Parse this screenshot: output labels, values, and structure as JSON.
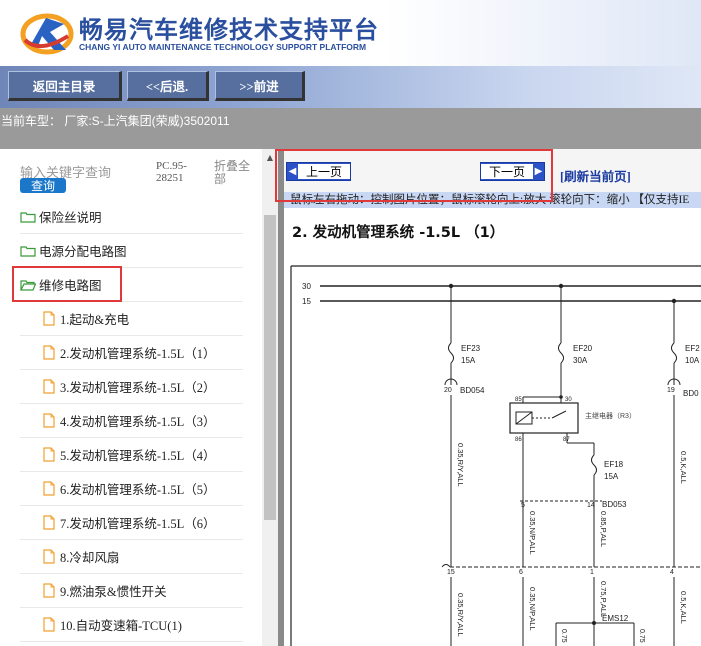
{
  "header": {
    "title_cn": "畅易汽车维修技术支持平台",
    "title_en": "CHANG YI AUTO MAINTENANCE TECHNOLOGY SUPPORT PLATFORM"
  },
  "nav": {
    "home_label": "返回主目录",
    "back_label": "<<后退.",
    "forward_label": ">>前进"
  },
  "model": {
    "text": "当前车型： 厂家:S-上汽集团(荣威)3502011"
  },
  "sidebar": {
    "search_placeholder": "输入关键字查询",
    "search_button": "查询",
    "pc_version": "PC.95-28251",
    "collapse_all": "折叠全部",
    "folders": [
      {
        "label": "保险丝说明"
      },
      {
        "label": "电源分配电路图"
      },
      {
        "label": "维修电路图"
      }
    ],
    "items": [
      {
        "label": "1.起动&充电"
      },
      {
        "label": "2.发动机管理系统-1.5L（1）"
      },
      {
        "label": "3.发动机管理系统-1.5L（2）"
      },
      {
        "label": "4.发动机管理系统-1.5L（3）"
      },
      {
        "label": "5.发动机管理系统-1.5L（4）"
      },
      {
        "label": "6.发动机管理系统-1.5L（5）"
      },
      {
        "label": "7.发动机管理系统-1.5L（6）"
      },
      {
        "label": "8.冷却风扇"
      },
      {
        "label": "9.燃油泵&惯性开关"
      },
      {
        "label": "10.自动变速箱-TCU(1)"
      }
    ]
  },
  "content": {
    "prev_page": "上一页",
    "next_page": "下一页",
    "refresh": "[刷新当前页]",
    "hint": "鼠标左右拖动：控制图片位置；鼠标滚轮向上:放大   滚轮向下：缩小 【仅支持IE",
    "doc_title": "2. 发动机管理系统 -1.5L （1）"
  },
  "diagram": {
    "bus_30": "30",
    "bus_15": "15",
    "fuses": [
      {
        "name": "EF23",
        "rating": "15A",
        "pin": "20",
        "conn": "BD054"
      },
      {
        "name": "EF20",
        "rating": "30A"
      },
      {
        "name": "EF2",
        "rating": "10A",
        "pin": "19",
        "conn": "BD0"
      },
      {
        "name": "EF18",
        "rating": "15A",
        "pin": "14",
        "conn": "BD053"
      }
    ],
    "relay_label": "主继电器（R3）",
    "relay_pins": [
      "85",
      "30",
      "86",
      "87"
    ],
    "wire_labels": [
      "0.35,R/Y,ALL",
      "0.35,N/P,ALL",
      "0.85,P,ALL",
      "0.5,K,ALL",
      "0.75,P,ALL",
      "0.35,R/Y,ALL",
      "0.35,N/P,ALL",
      "0.5,K,ALL"
    ],
    "pins_mid": [
      "5",
      "15",
      "6",
      "1",
      "4"
    ],
    "ems": "EMS12",
    "bottom_labels": [
      "0.75",
      "0.75"
    ]
  },
  "colors": {
    "brand_blue": "#2a4f9e",
    "highlight_red": "#e0393b",
    "folder_green": "#3a9a3a",
    "doc_orange": "#f0a030"
  }
}
